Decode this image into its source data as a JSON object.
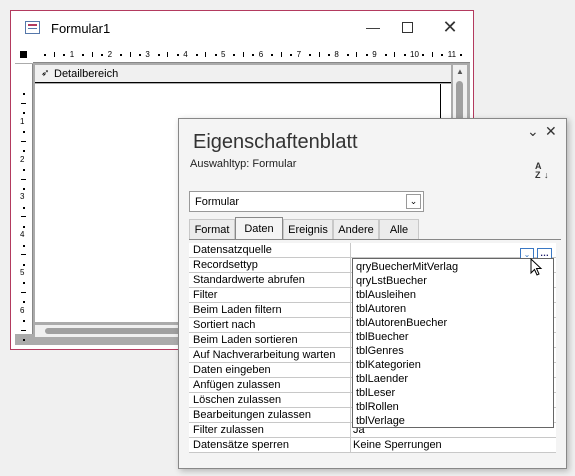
{
  "form_window": {
    "title": "Formular1",
    "minimize": "—",
    "close": "✕",
    "section_label": "Detailbereich",
    "ruler_top": [
      "1",
      "2",
      "3",
      "4",
      "5",
      "6",
      "7",
      "8",
      "9",
      "10",
      "11"
    ],
    "ruler_left": [
      "1",
      "2",
      "3",
      "4",
      "5",
      "6"
    ]
  },
  "property_sheet": {
    "title": "Eigenschaftenblatt",
    "selection_type": "Auswahltyp:  Formular",
    "object_combo": "Formular",
    "tabs": [
      "Format",
      "Daten",
      "Ereignis",
      "Andere",
      "Alle"
    ],
    "active_tab": "Daten",
    "properties": [
      {
        "label": "Datensatzquelle",
        "value": ""
      },
      {
        "label": "Recordsettyp",
        "value": ""
      },
      {
        "label": "Standardwerte abrufen",
        "value": ""
      },
      {
        "label": "Filter",
        "value": ""
      },
      {
        "label": "Beim Laden filtern",
        "value": ""
      },
      {
        "label": "Sortiert nach",
        "value": ""
      },
      {
        "label": "Beim Laden sortieren",
        "value": ""
      },
      {
        "label": "Auf Nachverarbeitung warten",
        "value": ""
      },
      {
        "label": "Daten eingeben",
        "value": ""
      },
      {
        "label": "Anfügen zulassen",
        "value": ""
      },
      {
        "label": "Löschen zulassen",
        "value": ""
      },
      {
        "label": "Bearbeitungen zulassen",
        "value": ""
      },
      {
        "label": "Filter zulassen",
        "value": "Ja"
      },
      {
        "label": "Datensätze sperren",
        "value": "Keine Sperrungen"
      }
    ],
    "dropdown_items": [
      "qryBuecherMitVerlag",
      "qryLstBuecher",
      "tblAusleihen",
      "tblAutoren",
      "tblAutorenBuecher",
      "tblBuecher",
      "tblGenres",
      "tblKategorien",
      "tblLaender",
      "tblLeser",
      "tblRollen",
      "tblVerlage"
    ]
  },
  "colors": {
    "form_border": "#b33a5e",
    "dropdown_accent": "#3a78c4",
    "workspace_gray": "#ababab"
  }
}
